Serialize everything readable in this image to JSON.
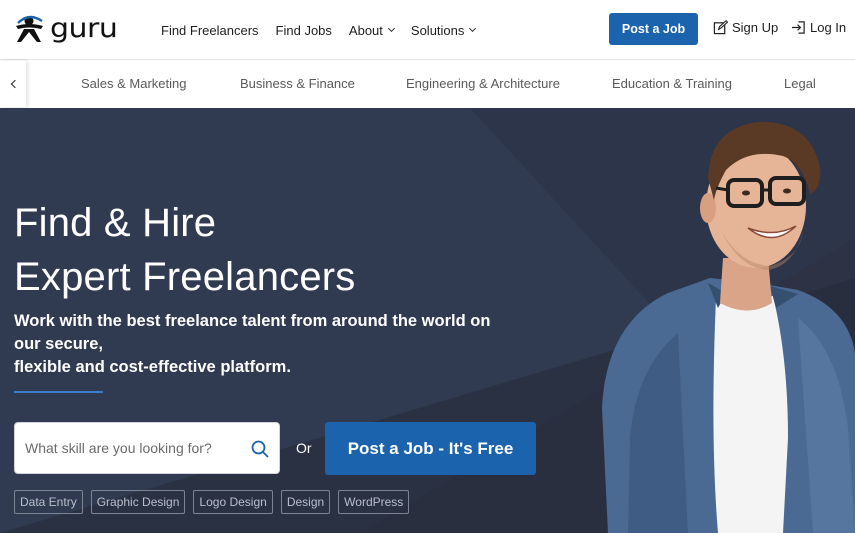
{
  "brand": {
    "name": "guru"
  },
  "nav": {
    "links": [
      {
        "label": "Find Freelancers",
        "dropdown": false
      },
      {
        "label": "Find Jobs",
        "dropdown": false
      },
      {
        "label": "About",
        "dropdown": true
      },
      {
        "label": "Solutions",
        "dropdown": true
      }
    ],
    "post_job": "Post a Job",
    "sign_up": "Sign Up",
    "log_in": "Log In"
  },
  "categories": {
    "items": [
      "Sales & Marketing",
      "Business & Finance",
      "Engineering & Architecture",
      "Education & Training",
      "Legal"
    ]
  },
  "hero": {
    "headline_line1": "Find & Hire",
    "headline_line2": "Expert Freelancers",
    "sub_line1": "Work with the best freelance talent from around the world on our secure,",
    "sub_line2": "flexible and cost-effective platform.",
    "search_placeholder": "What skill are you looking for?",
    "or": "Or",
    "cta": "Post a Job - It's Free",
    "tags": [
      "Data Entry",
      "Graphic Design",
      "Logo Design",
      "Design",
      "WordPress"
    ]
  },
  "colors": {
    "primary": "#1c63ad",
    "hero_bg": "#2f3548",
    "accent_line": "#3a7fd0"
  }
}
